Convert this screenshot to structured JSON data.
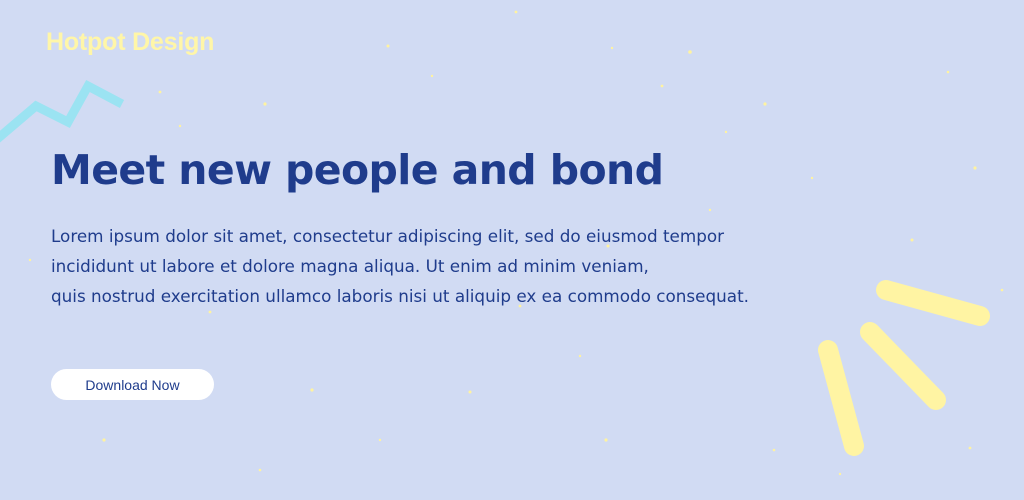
{
  "brand": {
    "name": "Hotpot Design"
  },
  "hero": {
    "headline": "Meet new people and bond",
    "body_lines": [
      "Lorem ipsum dolor sit amet, consectetur adipiscing elit, sed do eiusmod tempor",
      "incididunt ut labore et dolore magna aliqua. Ut enim ad minim veniam,",
      "quis nostrud exercitation ullamco laboris nisi ut aliquip ex ea commodo consequat."
    ],
    "cta_label": "Download Now"
  },
  "colors": {
    "background": "#d1dbf3",
    "heading": "#1f3c8c",
    "brand": "#fff6a8",
    "accent_cyan": "#9be3f2",
    "accent_yellow": "#fff4a3"
  },
  "decorations": [
    "zigzag-decoration",
    "sparkle-rays-decoration",
    "confetti-dots"
  ]
}
